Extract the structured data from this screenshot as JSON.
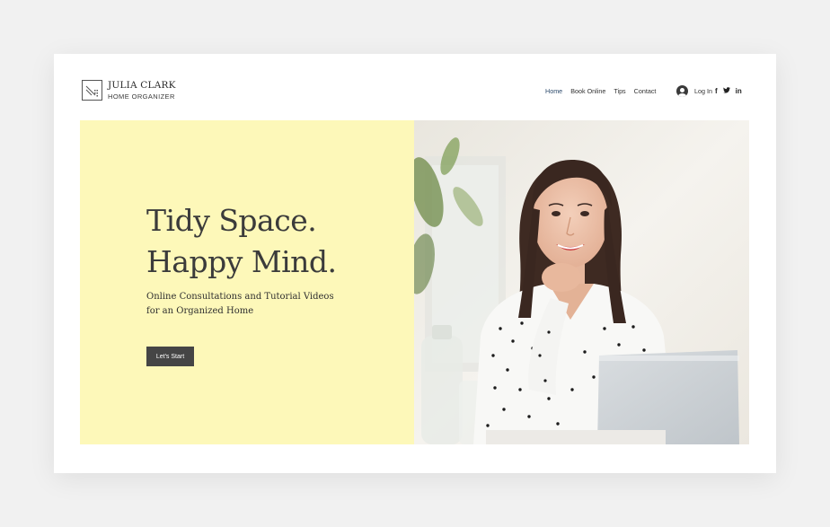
{
  "brand": {
    "name": "JULIA CLARK",
    "subtitle": "HOME ORGANIZER"
  },
  "nav": {
    "items": [
      "Home",
      "Book Online",
      "Tips",
      "Contact"
    ],
    "active": "Home"
  },
  "account": {
    "login_label": "Log In"
  },
  "social": {
    "facebook_glyph": "f",
    "twitter_glyph": "t",
    "linkedin_glyph": "in"
  },
  "hero": {
    "headline_line1": "Tidy Space.",
    "headline_line2": "Happy Mind.",
    "subtext_line1": "Online Consultations and Tutorial Videos",
    "subtext_line2": "for an Organized Home",
    "cta_label": "Let's Start",
    "panel_color": "#fdf8b9",
    "image_subject": "smiling woman at laptop"
  },
  "colors": {
    "page_bg": "#f1f1f1",
    "card_bg": "#ffffff",
    "button_bg": "#454545",
    "nav_active": "#2c4a6b"
  }
}
